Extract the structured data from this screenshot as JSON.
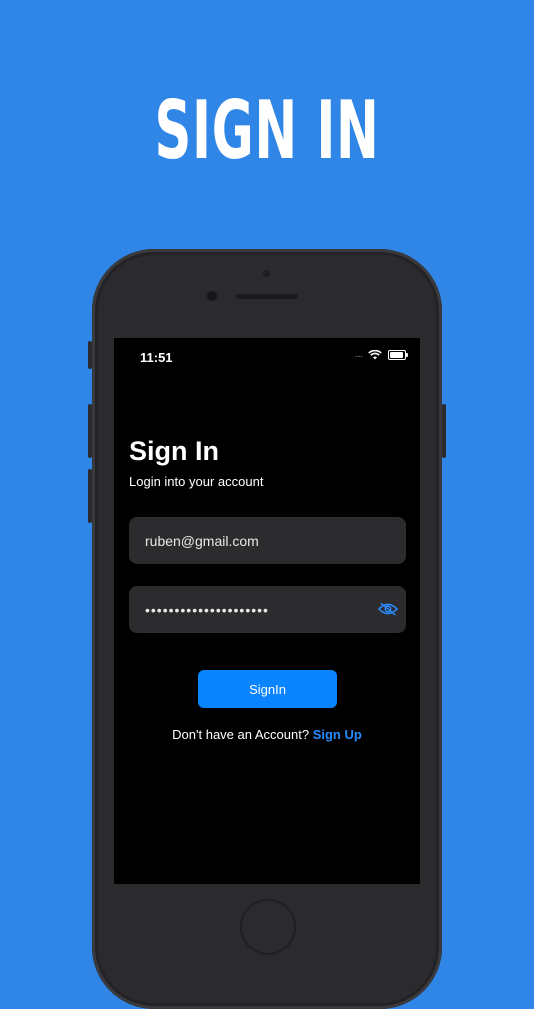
{
  "hero": {
    "title": "SIGN IN"
  },
  "status_bar": {
    "time": "11:51",
    "signal": "....",
    "icons": [
      "wifi-icon",
      "battery-icon"
    ]
  },
  "screen": {
    "title": "Sign In",
    "subtitle": "Login into your account",
    "email_value": "ruben@gmail.com",
    "password_masked": "•••••••••••••••••••••",
    "password_toggle_icon": "eye-icon",
    "signin_label": "SignIn",
    "footer_text": "Don't have an Account? ",
    "footer_link": "Sign Up"
  },
  "colors": {
    "background": "#2f86e6",
    "accent": "#0a84ff",
    "screen_bg": "#000000",
    "field_bg": "#2c2c2e",
    "device": "#2b2b2e"
  }
}
